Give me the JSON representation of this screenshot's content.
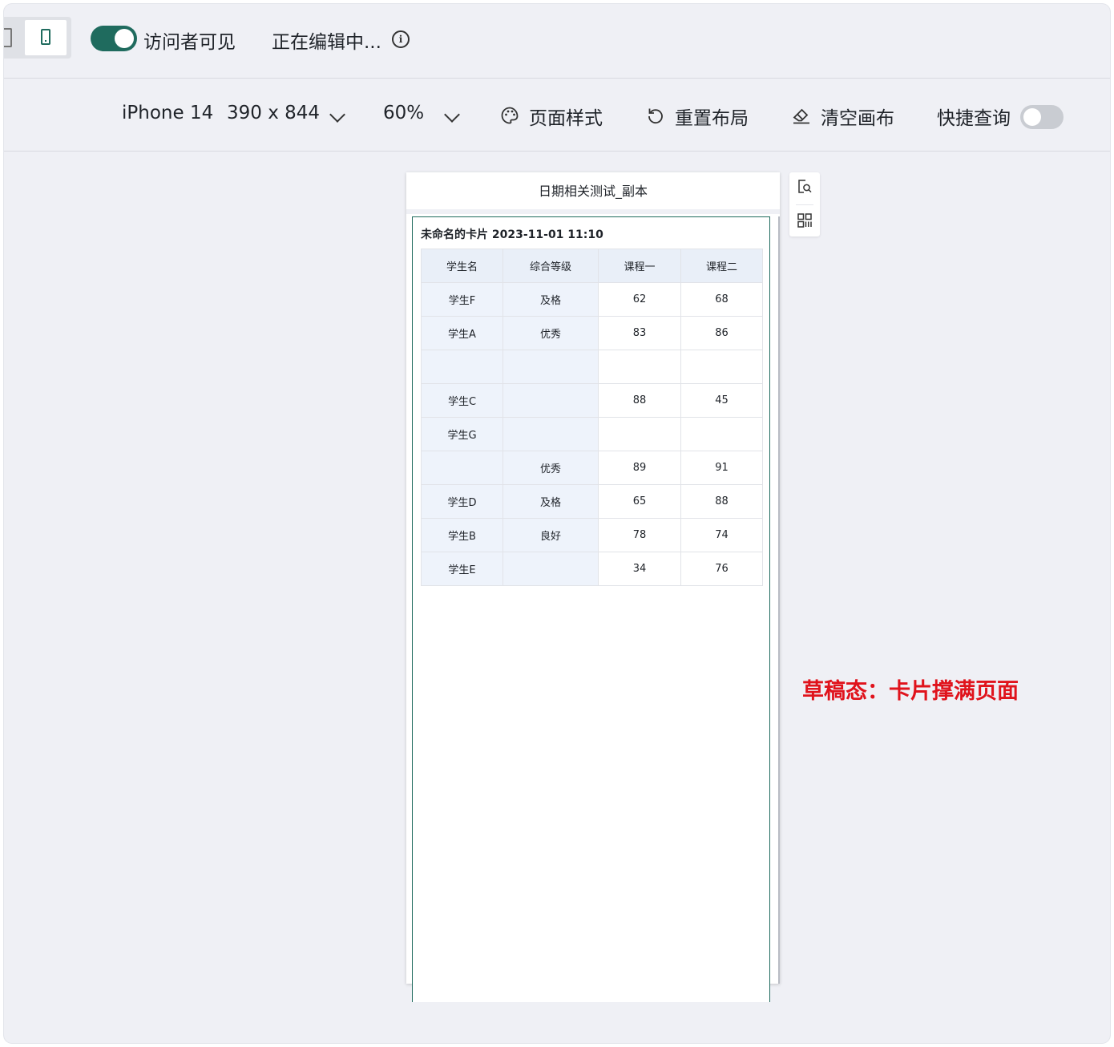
{
  "topbar": {
    "visitor_label": "访问者可见",
    "editing_label": "正在编辑中...",
    "info_glyph": "i"
  },
  "toolbar": {
    "device": "iPhone 14",
    "resolution": "390 x 844",
    "zoom": "60%",
    "page_style": "页面样式",
    "reset_layout": "重置布局",
    "clear_canvas": "清空画布",
    "quick_query": "快捷查询"
  },
  "phone": {
    "title": "日期相关测试_副本",
    "card_title": "未命名的卡片 2023-11-01 11:10",
    "table": {
      "headers": [
        "学生名",
        "综合等级",
        "课程一",
        "课程二"
      ],
      "rows": [
        [
          "学生F",
          "及格",
          "62",
          "68"
        ],
        [
          "学生A",
          "优秀",
          "83",
          "86"
        ],
        [
          "",
          "",
          "",
          ""
        ],
        [
          "学生C",
          "",
          "88",
          "45"
        ],
        [
          "学生G",
          "",
          "",
          ""
        ],
        [
          "",
          "优秀",
          "89",
          "91"
        ],
        [
          "学生D",
          "及格",
          "65",
          "88"
        ],
        [
          "学生B",
          "良好",
          "78",
          "74"
        ],
        [
          "学生E",
          "",
          "34",
          "76"
        ]
      ]
    }
  },
  "annotation": "草稿态：卡片撑满页面",
  "colors": {
    "accent": "#1f6b5e",
    "annotation": "#e0131c",
    "header_bg": "#e9eff8"
  }
}
